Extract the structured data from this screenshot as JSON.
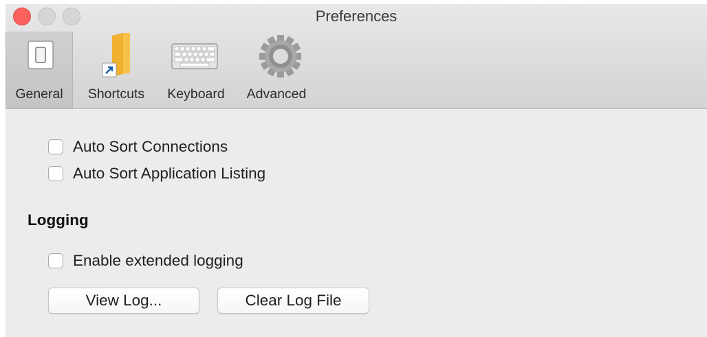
{
  "window": {
    "title": "Preferences",
    "controls": {
      "close_color": "#fc605c",
      "inactive_color": "#d6d6d6"
    }
  },
  "toolbar": {
    "tabs": [
      {
        "label": "General",
        "icon": "switch-icon",
        "selected": true
      },
      {
        "label": "Shortcuts",
        "icon": "folder-shortcut-icon",
        "selected": false
      },
      {
        "label": "Keyboard",
        "icon": "keyboard-icon",
        "selected": false
      },
      {
        "label": "Advanced",
        "icon": "gear-icon",
        "selected": false
      }
    ]
  },
  "general": {
    "options": [
      {
        "label": "Auto Sort Connections",
        "checked": false
      },
      {
        "label": "Auto Sort Application Listing",
        "checked": false
      }
    ]
  },
  "logging": {
    "heading": "Logging",
    "extended_label": "Enable extended logging",
    "extended_checked": false,
    "view_log_label": "View Log...",
    "clear_log_label": "Clear Log File"
  }
}
